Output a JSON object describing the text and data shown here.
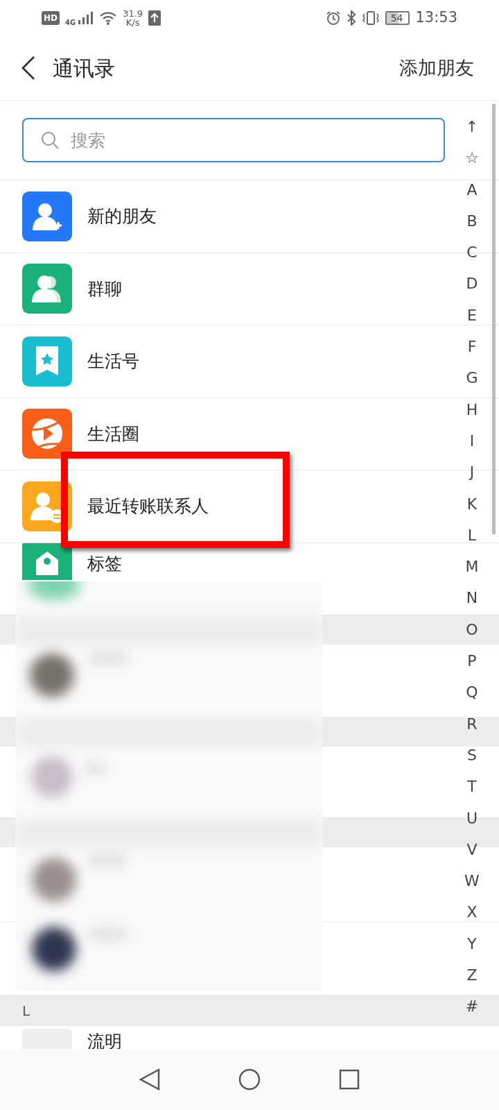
{
  "status_bar": {
    "hd": "HD",
    "network": "4G",
    "speed": "31.9",
    "speed_unit": "K/s",
    "battery": "54",
    "time": "13:53"
  },
  "header": {
    "title": "通讯录",
    "action": "添加朋友"
  },
  "search": {
    "placeholder": "搜索"
  },
  "menu_items": [
    {
      "label": "新的朋友",
      "kind": "add-contact",
      "color": "#2378f5"
    },
    {
      "label": "群聊",
      "kind": "group",
      "color": "#1bb17a"
    },
    {
      "label": "生活号",
      "kind": "bookmark",
      "color": "#19bdd0"
    },
    {
      "label": "生活圈",
      "kind": "play",
      "color": "#fb5f17"
    },
    {
      "label": "最近转账联系人",
      "kind": "transfer",
      "color": "#fba81f"
    },
    {
      "label": "标签",
      "kind": "tag",
      "color": "#1bb17a"
    }
  ],
  "sections": [
    {
      "header": "L",
      "contacts": [
        {
          "name": "流明"
        }
      ]
    }
  ],
  "index_letters": [
    "↑",
    "☆",
    "A",
    "B",
    "C",
    "D",
    "E",
    "F",
    "G",
    "H",
    "I",
    "J",
    "K",
    "L",
    "M",
    "N",
    "O",
    "P",
    "Q",
    "R",
    "S",
    "T",
    "U",
    "V",
    "W",
    "X",
    "Y",
    "Z",
    "#"
  ],
  "annotation": {
    "kind": "highlight"
  }
}
